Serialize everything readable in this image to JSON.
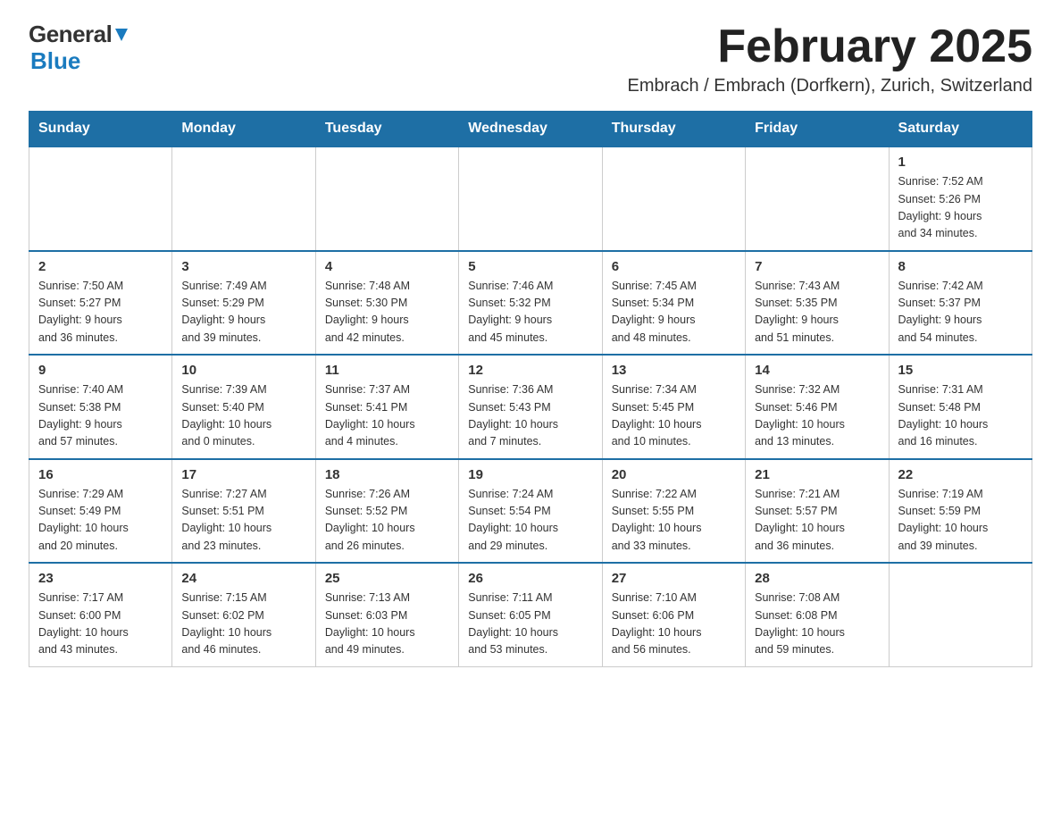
{
  "header": {
    "logo_general": "General",
    "logo_blue": "Blue",
    "title": "February 2025",
    "subtitle": "Embrach / Embrach (Dorfkern), Zurich, Switzerland"
  },
  "days_of_week": [
    "Sunday",
    "Monday",
    "Tuesday",
    "Wednesday",
    "Thursday",
    "Friday",
    "Saturday"
  ],
  "weeks": [
    [
      {
        "day": "",
        "info": ""
      },
      {
        "day": "",
        "info": ""
      },
      {
        "day": "",
        "info": ""
      },
      {
        "day": "",
        "info": ""
      },
      {
        "day": "",
        "info": ""
      },
      {
        "day": "",
        "info": ""
      },
      {
        "day": "1",
        "info": "Sunrise: 7:52 AM\nSunset: 5:26 PM\nDaylight: 9 hours\nand 34 minutes."
      }
    ],
    [
      {
        "day": "2",
        "info": "Sunrise: 7:50 AM\nSunset: 5:27 PM\nDaylight: 9 hours\nand 36 minutes."
      },
      {
        "day": "3",
        "info": "Sunrise: 7:49 AM\nSunset: 5:29 PM\nDaylight: 9 hours\nand 39 minutes."
      },
      {
        "day": "4",
        "info": "Sunrise: 7:48 AM\nSunset: 5:30 PM\nDaylight: 9 hours\nand 42 minutes."
      },
      {
        "day": "5",
        "info": "Sunrise: 7:46 AM\nSunset: 5:32 PM\nDaylight: 9 hours\nand 45 minutes."
      },
      {
        "day": "6",
        "info": "Sunrise: 7:45 AM\nSunset: 5:34 PM\nDaylight: 9 hours\nand 48 minutes."
      },
      {
        "day": "7",
        "info": "Sunrise: 7:43 AM\nSunset: 5:35 PM\nDaylight: 9 hours\nand 51 minutes."
      },
      {
        "day": "8",
        "info": "Sunrise: 7:42 AM\nSunset: 5:37 PM\nDaylight: 9 hours\nand 54 minutes."
      }
    ],
    [
      {
        "day": "9",
        "info": "Sunrise: 7:40 AM\nSunset: 5:38 PM\nDaylight: 9 hours\nand 57 minutes."
      },
      {
        "day": "10",
        "info": "Sunrise: 7:39 AM\nSunset: 5:40 PM\nDaylight: 10 hours\nand 0 minutes."
      },
      {
        "day": "11",
        "info": "Sunrise: 7:37 AM\nSunset: 5:41 PM\nDaylight: 10 hours\nand 4 minutes."
      },
      {
        "day": "12",
        "info": "Sunrise: 7:36 AM\nSunset: 5:43 PM\nDaylight: 10 hours\nand 7 minutes."
      },
      {
        "day": "13",
        "info": "Sunrise: 7:34 AM\nSunset: 5:45 PM\nDaylight: 10 hours\nand 10 minutes."
      },
      {
        "day": "14",
        "info": "Sunrise: 7:32 AM\nSunset: 5:46 PM\nDaylight: 10 hours\nand 13 minutes."
      },
      {
        "day": "15",
        "info": "Sunrise: 7:31 AM\nSunset: 5:48 PM\nDaylight: 10 hours\nand 16 minutes."
      }
    ],
    [
      {
        "day": "16",
        "info": "Sunrise: 7:29 AM\nSunset: 5:49 PM\nDaylight: 10 hours\nand 20 minutes."
      },
      {
        "day": "17",
        "info": "Sunrise: 7:27 AM\nSunset: 5:51 PM\nDaylight: 10 hours\nand 23 minutes."
      },
      {
        "day": "18",
        "info": "Sunrise: 7:26 AM\nSunset: 5:52 PM\nDaylight: 10 hours\nand 26 minutes."
      },
      {
        "day": "19",
        "info": "Sunrise: 7:24 AM\nSunset: 5:54 PM\nDaylight: 10 hours\nand 29 minutes."
      },
      {
        "day": "20",
        "info": "Sunrise: 7:22 AM\nSunset: 5:55 PM\nDaylight: 10 hours\nand 33 minutes."
      },
      {
        "day": "21",
        "info": "Sunrise: 7:21 AM\nSunset: 5:57 PM\nDaylight: 10 hours\nand 36 minutes."
      },
      {
        "day": "22",
        "info": "Sunrise: 7:19 AM\nSunset: 5:59 PM\nDaylight: 10 hours\nand 39 minutes."
      }
    ],
    [
      {
        "day": "23",
        "info": "Sunrise: 7:17 AM\nSunset: 6:00 PM\nDaylight: 10 hours\nand 43 minutes."
      },
      {
        "day": "24",
        "info": "Sunrise: 7:15 AM\nSunset: 6:02 PM\nDaylight: 10 hours\nand 46 minutes."
      },
      {
        "day": "25",
        "info": "Sunrise: 7:13 AM\nSunset: 6:03 PM\nDaylight: 10 hours\nand 49 minutes."
      },
      {
        "day": "26",
        "info": "Sunrise: 7:11 AM\nSunset: 6:05 PM\nDaylight: 10 hours\nand 53 minutes."
      },
      {
        "day": "27",
        "info": "Sunrise: 7:10 AM\nSunset: 6:06 PM\nDaylight: 10 hours\nand 56 minutes."
      },
      {
        "day": "28",
        "info": "Sunrise: 7:08 AM\nSunset: 6:08 PM\nDaylight: 10 hours\nand 59 minutes."
      },
      {
        "day": "",
        "info": ""
      }
    ]
  ]
}
